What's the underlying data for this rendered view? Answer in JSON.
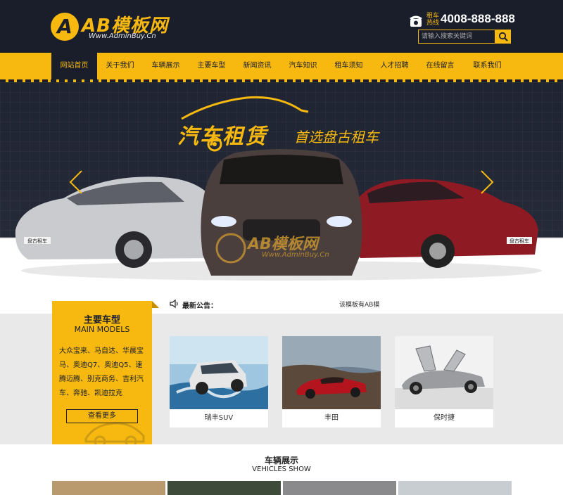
{
  "header": {
    "logo_letter": "A",
    "logo_text": "AB模板网",
    "logo_sub": "Www.AdminBuy.Cn",
    "hotline_label": "租车热线",
    "hotline_number": "4008-888-888",
    "search_placeholder": "请输入搜索关键词"
  },
  "nav": {
    "items": [
      "网站首页",
      "关于我们",
      "车辆展示",
      "主要车型",
      "新闻资讯",
      "汽车知识",
      "租车须知",
      "人才招聘",
      "在线留言",
      "联系我们"
    ],
    "active_index": 0
  },
  "banner": {
    "title": "汽车租赁",
    "subtitle": "首选盘古租车",
    "watermark_text": "AB模板网",
    "watermark_sub": "Www.AdminBuy.Cn",
    "plate_left": "盘古租车",
    "plate_right": "盘古租车"
  },
  "notice": {
    "label": "最新公告：",
    "text": "该模板有AB模"
  },
  "models": {
    "title": "主要车型",
    "title_en": "MAIN MODELS",
    "description": "大众宝来、马自达、华晨宝马、奥迪Q7、奥迪Q5、速腾迈腾、别克商务、吉利汽车、奔驰、凯迪拉克",
    "more_label": "查看更多",
    "cards": [
      {
        "label": "瑞丰SUV"
      },
      {
        "label": "丰田"
      },
      {
        "label": "保时捷"
      }
    ]
  },
  "vehicles": {
    "title": "车辆展示",
    "title_en": "VEHICLES SHOW"
  },
  "colors": {
    "dark": "#1a1e2b",
    "accent": "#f7b90f",
    "section_bg": "#e9e9e9"
  }
}
